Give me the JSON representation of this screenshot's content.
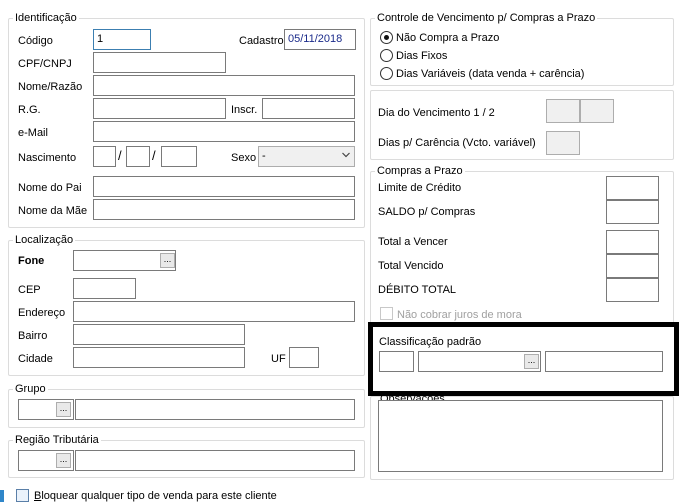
{
  "identificacao": {
    "title": "Identificação",
    "codigo_label": "Código",
    "codigo_value": "1",
    "cadastro_label": "Cadastro",
    "cadastro_value": "05/11/2018",
    "cpf_label": "CPF/CNPJ",
    "nome_label": "Nome/Razão",
    "rg_label": "R.G.",
    "inscr_label": "Inscr.",
    "email_label": "e-Mail",
    "nascimento_label": "Nascimento",
    "date_sep": "/",
    "sexo_label": "Sexo",
    "sexo_value": "-",
    "pai_label": "Nome do Pai",
    "mae_label": "Nome da Mãe"
  },
  "localizacao": {
    "title": "Localização",
    "fone_label": "Fone",
    "cep_label": "CEP",
    "endereco_label": "Endereço",
    "bairro_label": "Bairro",
    "cidade_label": "Cidade",
    "uf_label": "UF"
  },
  "grupo": {
    "title": "Grupo"
  },
  "regiao": {
    "title": "Região Tributária"
  },
  "vencimento": {
    "title": "Controle de Vencimento p/ Compras a Prazo",
    "options": [
      "Não Compra a Prazo",
      "Dias Fixos",
      "Dias Variáveis (data venda + carência)"
    ],
    "selected": 0,
    "dia_label": "Dia do Vencimento 1 / 2",
    "carencia_label": "Dias p/ Carência (Vcto. variável)"
  },
  "compras": {
    "title": "Compras a Prazo",
    "limite_label": "Limite de Crédito",
    "saldo_label": "SALDO p/ Compras",
    "total_vencer_label": "Total a Vencer",
    "total_vencido_label": "Total Vencido",
    "debito_label": "DÉBITO TOTAL",
    "juros_label": "Não cobrar juros de mora"
  },
  "classificacao": {
    "title": "Classificação padrão"
  },
  "observacoes": {
    "title": "Observações"
  },
  "bloquear_label": "Bloquear qualquer tipo de venda para este cliente",
  "dots": "..."
}
